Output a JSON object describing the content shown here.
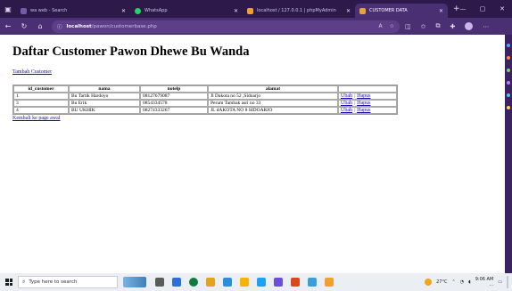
{
  "browser": {
    "tabs": [
      {
        "label": "wa web - Search",
        "color": "#7a5aa8",
        "active": false
      },
      {
        "label": "WhatsApp",
        "color": "#25d366",
        "active": false
      },
      {
        "label": "localhost / 127.0.0.1 | phpMyAdmin",
        "color": "#f0a030",
        "active": false
      },
      {
        "label": "CUSTOMER DATA",
        "color": "#e8a23a",
        "active": true
      }
    ],
    "new_tab": "+",
    "url_host": "localhost",
    "url_path": "/pawon/customerbase.php",
    "window_controls": {
      "minimize": "—",
      "restore": "▢",
      "close": "✕"
    }
  },
  "page": {
    "title": "Daftar Customer Pawon Dhewe Bu Wanda",
    "add_link": "Tambah Customer",
    "back_link": "Kembali ke page awal",
    "table": {
      "headers": [
        "id_customer",
        "nama",
        "notelp",
        "alamat",
        ""
      ],
      "rows": [
        {
          "id": "1",
          "nama": "Bu Tartik Hardoyo",
          "notelp": "08127679087",
          "alamat": "Jl Dakota no 52 ,Sidoarjo",
          "edit": "Ubah",
          "sep": "|",
          "delete": "Hapus"
        },
        {
          "id": "3",
          "nama": "Bu Erik",
          "notelp": "0854334578",
          "alamat": "Perum Tambak asri no 33",
          "edit": "Ubah",
          "sep": "|",
          "delete": "Hapus"
        },
        {
          "id": "4",
          "nama": "BU UKHIK",
          "notelp": "08274333267",
          "alamat": "JL dAKOTA NO 8 SIDOARJO",
          "edit": "Ubah",
          "sep": "|",
          "delete": "Hapus"
        }
      ]
    }
  },
  "taskbar": {
    "search_placeholder": "Type here to search",
    "weather": "27°C",
    "time": "9:06 AM",
    "date": "…",
    "icon_colors": [
      "#5a5a5a",
      "#2c6fd6",
      "#0f7b3f",
      "#e2a41b",
      "#2b8fd6",
      "#f5b400",
      "#1da1f2",
      "#6b4fd8",
      "#d9491d",
      "#3a9fd8",
      "#f0a030"
    ]
  }
}
